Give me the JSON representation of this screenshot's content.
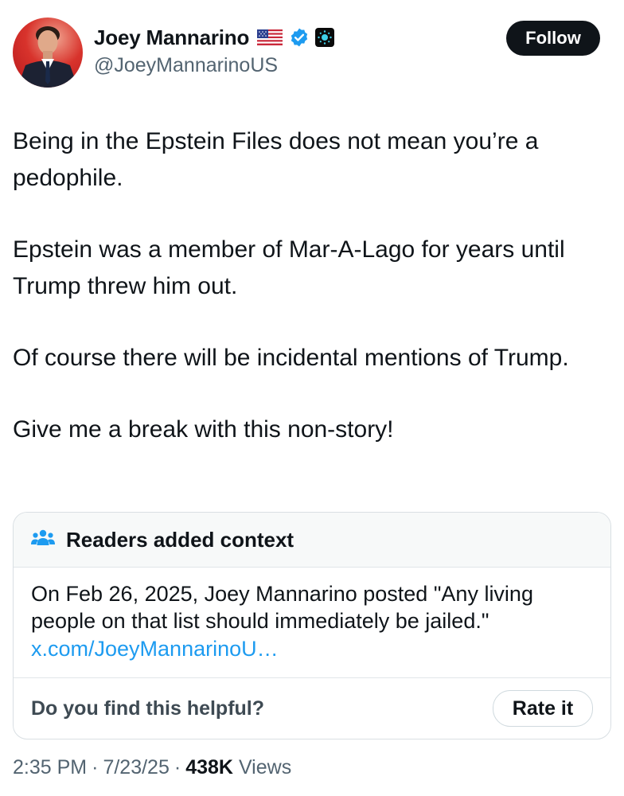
{
  "author": {
    "display_name": "Joey Mannarino",
    "handle": "@JoeyMannarinoUS",
    "flag_icon": "us-flag-icon",
    "verified_icon": "blue-verified-badge-icon",
    "affiliation_icon": "affiliate-badge-icon"
  },
  "follow_button": {
    "label": "Follow"
  },
  "tweet": {
    "paragraphs": [
      "Being in the Epstein Files does not mean you’re a pedophile.",
      "Epstein was a member of Mar-A-Lago for years until Trump threw him out.",
      "Of course there will be incidental mentions of Trump.",
      "Give me a break with this non-story!"
    ]
  },
  "community_note": {
    "header_icon": "people-group-icon",
    "title": "Readers added context",
    "text": "On Feb 26, 2025, Joey Mannarino posted \"Any living people on that list should immediately be jailed.\"",
    "link": "x.com/JoeyMannarinoU…",
    "question": "Do you find this helpful?",
    "rate_label": "Rate it"
  },
  "meta": {
    "time": "2:35 PM",
    "separator": "·",
    "date": "7/23/25",
    "views_count": "438K",
    "views_label": "Views"
  },
  "colors": {
    "text": "#0f1419",
    "secondary": "#536471",
    "link": "#1d9bf0",
    "verified": "#1d9bf0",
    "button_dark": "#0f1419"
  }
}
